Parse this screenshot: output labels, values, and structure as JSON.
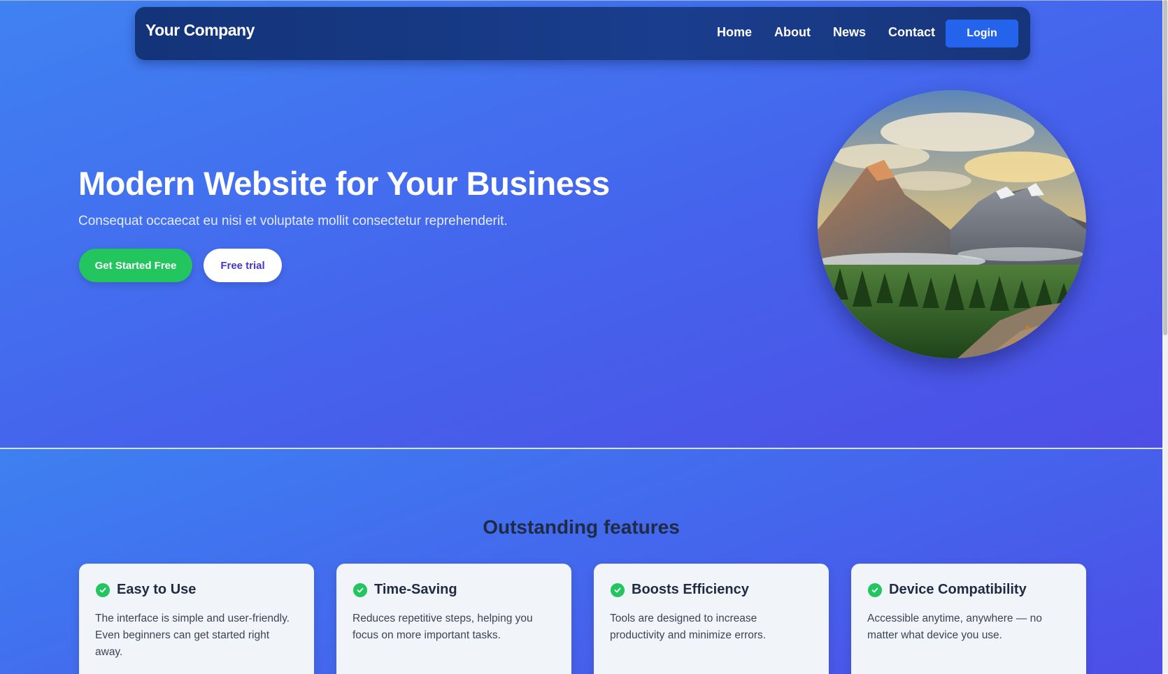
{
  "navbar": {
    "brand": "Your Company",
    "links": [
      "Home",
      "About",
      "News",
      "Contact"
    ],
    "login_label": "Login"
  },
  "hero": {
    "title": "Modern Website for Your Business",
    "subtitle": "Consequat occaecat eu nisi et voluptate mollit consectetur reprehenderit.",
    "primary_cta": "Get Started Free",
    "secondary_cta": "Free trial",
    "image_icon": "mountain-landscape-image"
  },
  "features": {
    "title": "Outstanding features",
    "cards": [
      {
        "title": "Easy to Use",
        "description": "The interface is simple and user-friendly. Even beginners can get started right away."
      },
      {
        "title": "Time-Saving",
        "description": "Reduces repetitive steps, helping you focus on more important tasks."
      },
      {
        "title": "Boosts Efficiency",
        "description": "Tools are designed to increase productivity and minimize errors."
      },
      {
        "title": "Device Compatibility",
        "description": "Accessible anytime, anywhere — no matter what device you use."
      }
    ]
  },
  "colors": {
    "primary_button": "#22c55e",
    "login_button": "#2463eb",
    "navbar": "#1a3d8d",
    "hero_gradient_start": "#3f82f2",
    "hero_gradient_end": "#4d4ee6",
    "card_background": "#f1f4f8"
  }
}
